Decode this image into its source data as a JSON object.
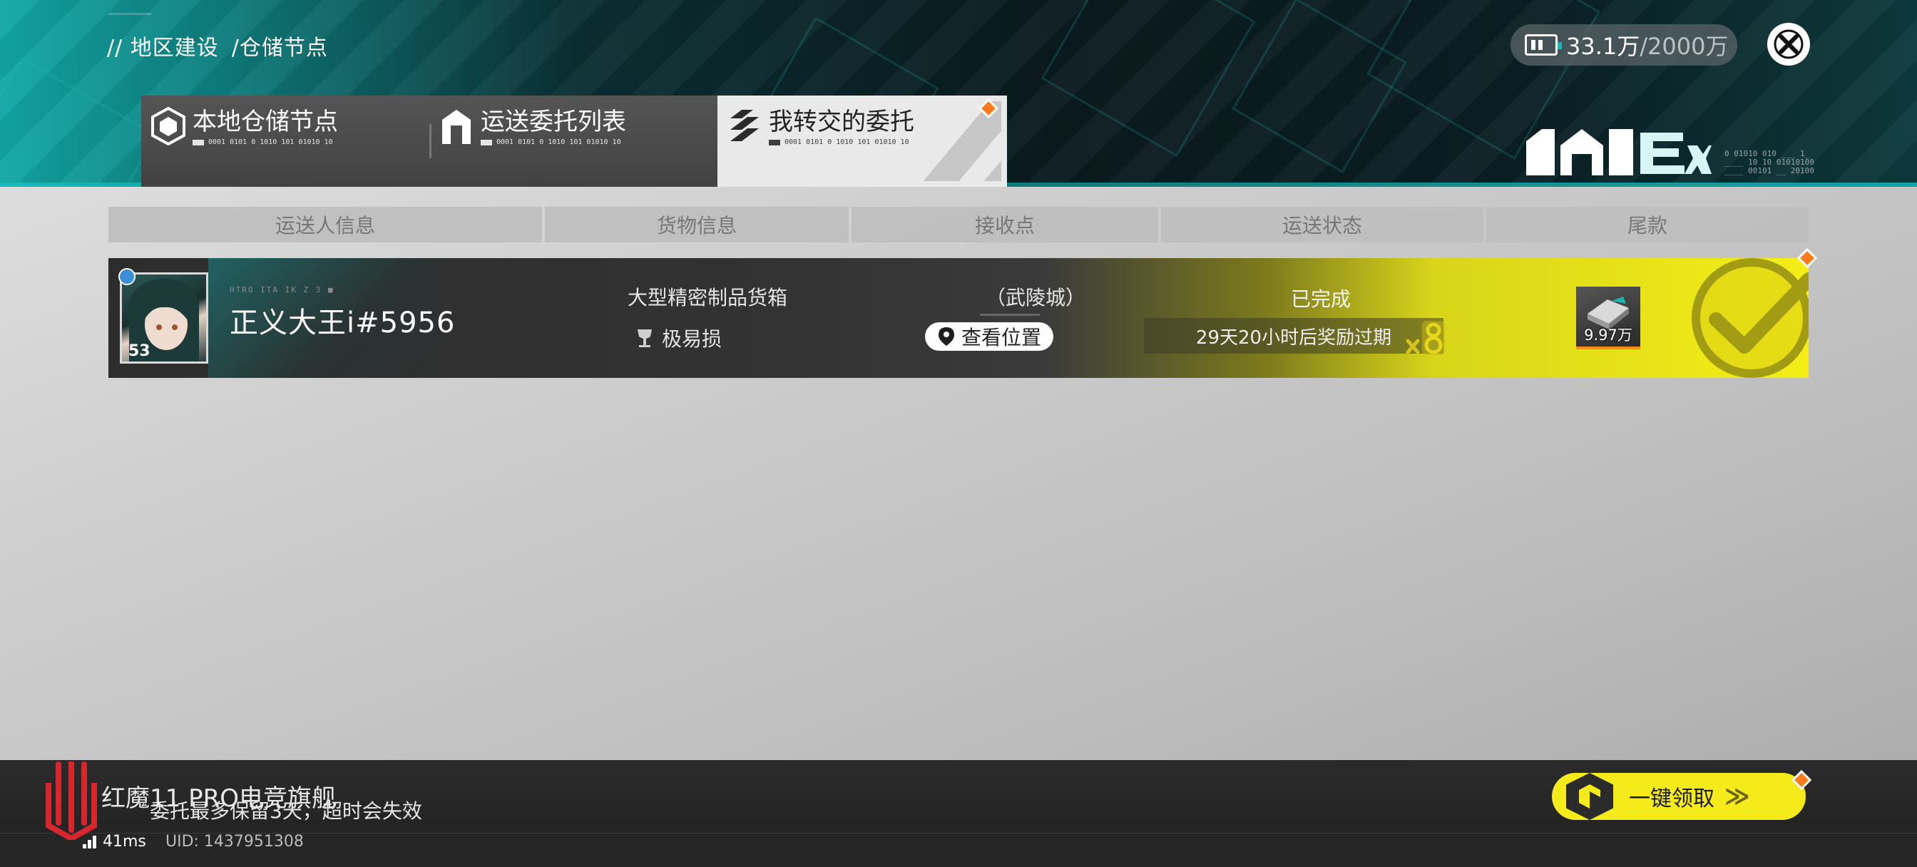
{
  "breadcrumb": {
    "root": "// 地区建设",
    "current": "/仓储节点"
  },
  "currency": {
    "current": "33.1万",
    "max": "/2000万"
  },
  "brand": {
    "binary": "0 01010 010 ___ 1_\n____ 10 10 01010100\n____ 00101 __ 20100"
  },
  "tabs": [
    {
      "label": "本地仓储节点",
      "sub": "0001 0101 0 1010 101 01010 10",
      "active": false,
      "icon": "cube-icon"
    },
    {
      "label": "运送委托列表",
      "sub": "0001 0101 0 1010 101 01010 10",
      "active": false,
      "icon": "house-icon"
    },
    {
      "label": "我转交的委托",
      "sub": "0001 0101 0 1010 101 01010 10",
      "active": true,
      "icon": "stack-icon"
    }
  ],
  "table": {
    "headers": [
      "运送人信息",
      "货物信息",
      "接收点",
      "运送状态",
      "尾款"
    ],
    "rows": [
      {
        "player_tag": "HTRO ITA IK Z 3 ■",
        "player_name": "正义大王i#5956",
        "level": "53",
        "cargo_name": "大型精密制品货箱",
        "cargo_trait": "极易损",
        "receive_point": "（武陵城）",
        "view_location": "查看位置",
        "status": "已完成",
        "timer": "29天20小时后奖励过期",
        "reward_amount": "9.97万"
      }
    ]
  },
  "device": {
    "watermark": "红魔11 PRO电竞旗舰"
  },
  "notice": "委托最多保留3天，超时会失效",
  "footer": {
    "ping": "41ms",
    "uid": "UID: 1437951308"
  },
  "claim_all": {
    "label": "一键领取",
    "arrows": "≫"
  },
  "colors": {
    "accent_teal": "#12a8a6",
    "accent_yellow": "#f4ee16",
    "accent_orange": "#ff7a1a"
  }
}
